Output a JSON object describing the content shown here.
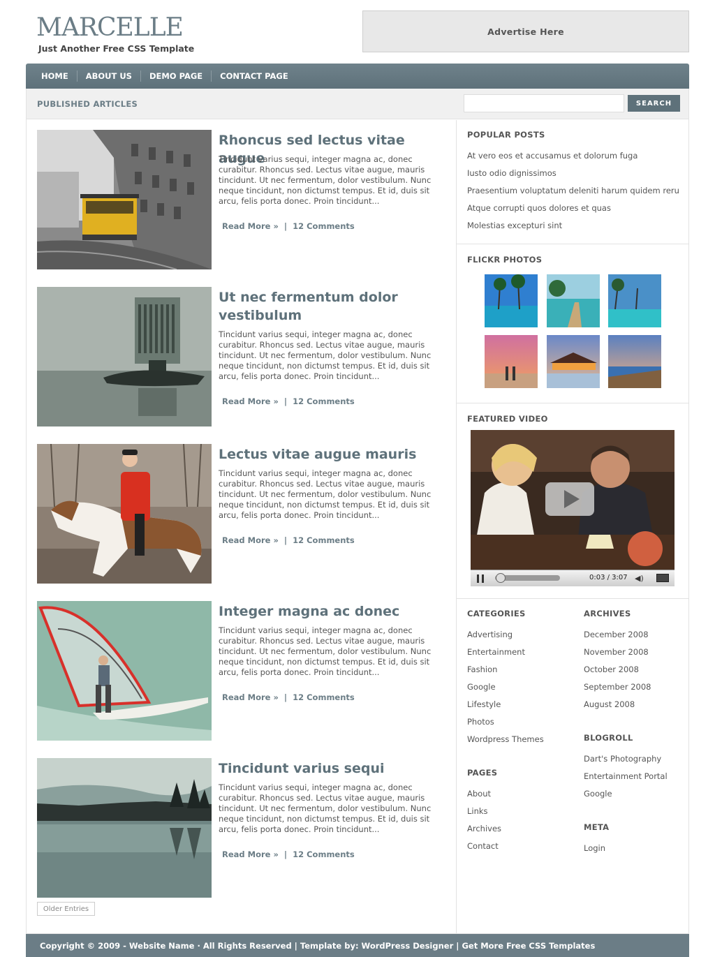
{
  "header": {
    "logo": "MARCELLE",
    "tagline": "Just Another Free CSS Template",
    "advert": "Advertise Here"
  },
  "nav": [
    "HOME",
    "ABOUT US",
    "DEMO PAGE",
    "CONTACT PAGE"
  ],
  "subbar": {
    "title": "PUBLISHED ARTICLES",
    "search_button": "SEARCH"
  },
  "articles": [
    {
      "title": "Rhoncus sed lectus vitae augue",
      "body": "Tincidunt varius sequi, integer magna ac, donec curabitur. Rhoncus sed. Lectus vitae augue, mauris tincidunt. Ut nec fermentum, dolor vestibulum. Nunc neque tincidunt, non dictumst tempus. Et id, duis sit arcu, felis porta donec. Proin tincidunt...",
      "read_more": "Read More »",
      "comments": "12 Comments"
    },
    {
      "title": "Ut nec fermentum dolor vestibulum",
      "body": "Tincidunt varius sequi, integer magna ac, donec curabitur. Rhoncus sed. Lectus vitae augue, mauris tincidunt. Ut nec fermentum, dolor vestibulum. Nunc neque tincidunt, non dictumst tempus. Et id, duis sit arcu, felis porta donec. Proin tincidunt...",
      "read_more": "Read More »",
      "comments": "12 Comments"
    },
    {
      "title": "Lectus vitae augue mauris",
      "body": "Tincidunt varius sequi, integer magna ac, donec curabitur. Rhoncus sed. Lectus vitae augue, mauris tincidunt. Ut nec fermentum, dolor vestibulum. Nunc neque tincidunt, non dictumst tempus. Et id, duis sit arcu, felis porta donec. Proin tincidunt...",
      "read_more": "Read More »",
      "comments": "12 Comments"
    },
    {
      "title": "Integer magna ac donec",
      "body": "Tincidunt varius sequi, integer magna ac, donec curabitur. Rhoncus sed. Lectus vitae augue, mauris tincidunt. Ut nec fermentum, dolor vestibulum. Nunc neque tincidunt, non dictumst tempus. Et id, duis sit arcu, felis porta donec. Proin tincidunt...",
      "read_more": "Read More »",
      "comments": "12 Comments"
    },
    {
      "title": "Tincidunt varius sequi",
      "body": "Tincidunt varius sequi, integer magna ac, donec curabitur. Rhoncus sed. Lectus vitae augue, mauris tincidunt. Ut nec fermentum, dolor vestibulum. Nunc neque tincidunt, non dictumst tempus. Et id, duis sit arcu, felis porta donec. Proin tincidunt...",
      "read_more": "Read More »",
      "comments": "12 Comments"
    }
  ],
  "older_entries": "Older Entries",
  "sidebar": {
    "popular_title": "POPULAR POSTS",
    "popular": [
      "At vero eos et accusamus et dolorum fuga",
      "Iusto odio dignissimos",
      "Praesentium voluptatum deleniti harum quidem reru",
      "Atque corrupti quos dolores et quas",
      "Molestias excepturi sint"
    ],
    "flickr_title": "FLICKR PHOTOS",
    "video_title": "FEATURED VIDEO",
    "video_time": "0:03 / 3:07",
    "categories_title": "CATEGORIES",
    "categories": [
      "Advertising",
      "Entertainment",
      "Fashion",
      "Google",
      "Lifestyle",
      "Photos",
      "Wordpress Themes"
    ],
    "archives_title": "ARCHIVES",
    "archives": [
      "December 2008",
      "November 2008",
      "October 2008",
      "September 2008",
      "August 2008"
    ],
    "blogroll_title": "BLOGROLL",
    "blogroll": [
      "Dart's Photography",
      "Entertainment Portal",
      "Google"
    ],
    "pages_title": "PAGES",
    "pages": [
      "About",
      "Links",
      "Archives",
      "Contact"
    ],
    "meta_title": "META",
    "meta": [
      "Login"
    ]
  },
  "footer": "Copyright © 2009 - Website Name · All Rights Reserved | Template by: WordPress Designer | Get More Free CSS Templates",
  "colors": {
    "accent": "#5e717a",
    "nav": "#6b7d86",
    "subbar": "#f0f0f0"
  }
}
